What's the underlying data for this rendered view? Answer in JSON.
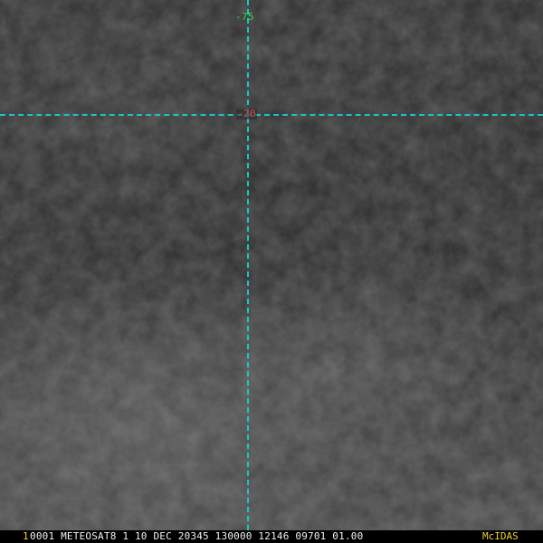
{
  "image": {
    "grid": {
      "line_color": "#19c6c6",
      "longitude_label": "-75",
      "longitude_label_color": "#34d34a",
      "latitude_label": "-20",
      "latitude_label_color": "#e04747"
    }
  },
  "status_bar": {
    "frame_number": "1",
    "text": "0001 METEOSAT8    1 10 DEC 20345 130000 12146 09701 01.00",
    "brand": "McIDAS",
    "text_color": "#f2f2f2",
    "accent_color": "#f0d320"
  }
}
